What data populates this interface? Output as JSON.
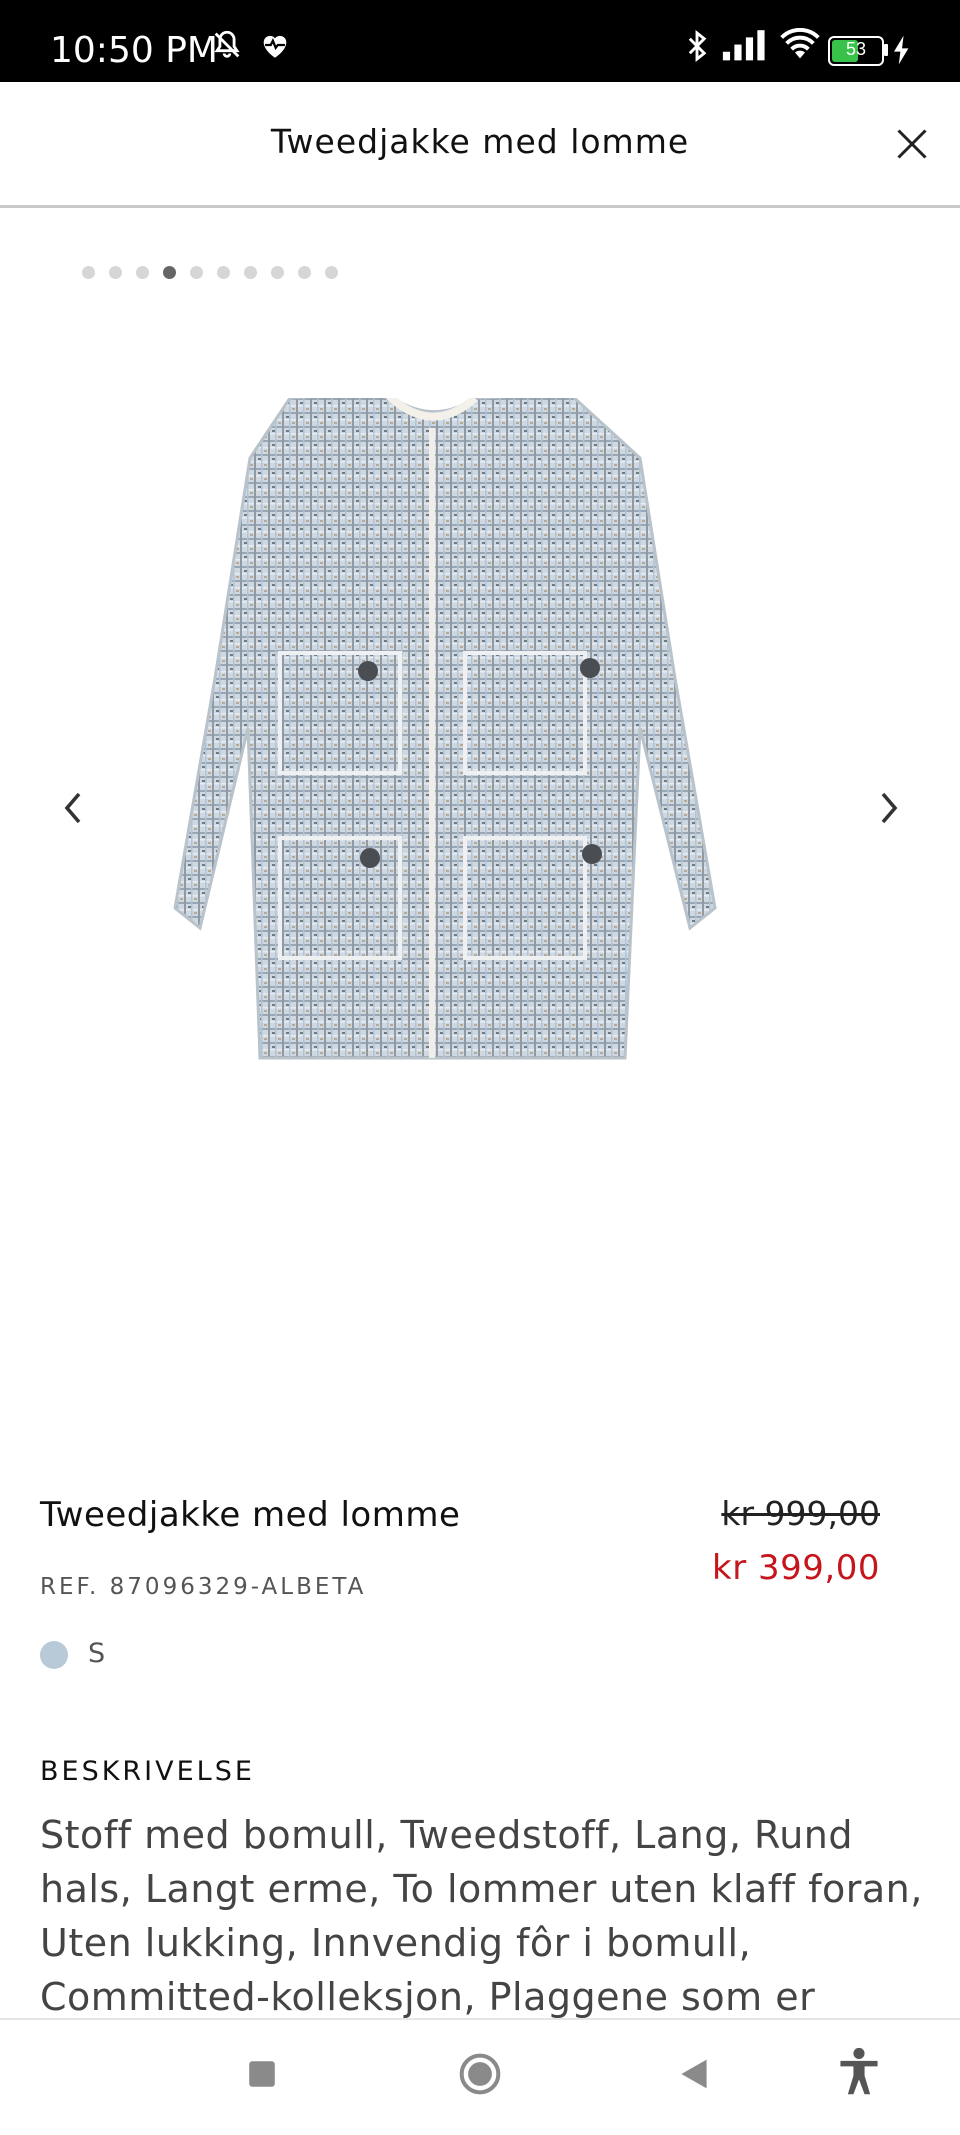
{
  "status_bar": {
    "time": "10:50 PM",
    "battery": "53",
    "icons": [
      "mute-icon",
      "health-icon",
      "bluetooth-icon",
      "signal-icon",
      "wifi-icon",
      "battery-icon",
      "charging-icon"
    ]
  },
  "header": {
    "title": "Tweedjakke med lomme",
    "close_icon": "close-icon"
  },
  "gallery": {
    "image_count": 10,
    "active_index": 3,
    "prev_icon": "chevron-left-icon",
    "next_icon": "chevron-right-icon"
  },
  "product": {
    "title": "Tweedjakke med lomme",
    "old_price": "kr 999,00",
    "new_price": "kr 399,00",
    "ref": "REF. 87096329-ALBETA",
    "color_hex": "#b8cad8",
    "size": "S"
  },
  "description": {
    "heading": "BESKRIVELSE",
    "text": "Stoff med bomull, Tweedstoff, Lang, Rund hals, Langt erme, To lommer uten klaff foran, Uten lukking, Innvendig fôr i bomull, Committed-kolleksjon, Plaggene som er merket som"
  },
  "navbar": {
    "items": [
      "recents-icon",
      "home-icon",
      "back-icon",
      "accessibility-icon"
    ]
  },
  "colors": {
    "price_red": "#c4161c",
    "status_bar_bg": "#000000"
  }
}
